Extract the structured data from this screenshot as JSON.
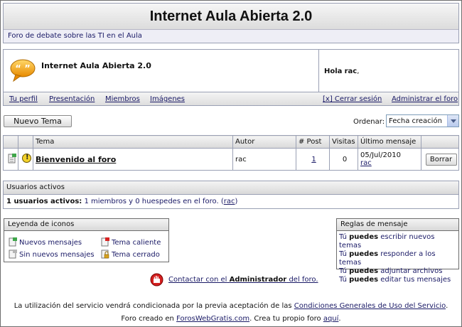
{
  "header": {
    "title": "Internet Aula Abierta 2.0",
    "subtitle": "Foro de debate sobre las TI en el Aula"
  },
  "panel": {
    "forum_name": "Internet Aula Abierta 2.0",
    "greeting_prefix": "Hola",
    "username": "rac",
    "greeting_suffix": ",",
    "links": {
      "profile": "Tu perfil",
      "presentation": "Presentación",
      "members": "Miembros",
      "images": "Imágenes",
      "logout": "[x] Cerrar sesión",
      "admin": "Administrar el foro"
    }
  },
  "toolbar": {
    "new_topic": "Nuevo Tema",
    "order_label": "Ordenar:",
    "order_value": "Fecha creación"
  },
  "topics_table": {
    "headers": {
      "topic": "Tema",
      "author": "Autor",
      "posts": "# Post",
      "visits": "Visitas",
      "last": "Último mensaje"
    },
    "rows": [
      {
        "title": "Bienvenido al foro",
        "author": "rac",
        "posts": "1",
        "visits": "0",
        "last_date": "05/Jul/2010",
        "last_user": "rac",
        "delete_label": "Borrar"
      }
    ]
  },
  "active_users": {
    "header": "Usuarios activos",
    "label": "1 usuarios activos:",
    "text": "1 miembros y 0 huespedes en el foro. (",
    "user": "rac",
    "close": ")"
  },
  "legend": {
    "header": "Leyenda de iconos",
    "items": [
      "Nuevos mensajes",
      "Sin nuevos mensajes",
      "Tema caliente",
      "Tema cerrado"
    ]
  },
  "rules": {
    "header": "Reglas de mensaje",
    "items": [
      {
        "pre": "Tú",
        "bold": "puedes",
        "post": "escribir nuevos temas"
      },
      {
        "pre": "Tú",
        "bold": "puedes",
        "post": "responder a los temas"
      },
      {
        "pre": "Tú",
        "bold": "puedes",
        "post": "adjuntar archivos"
      },
      {
        "pre": "Tú",
        "bold": "puedes",
        "post": "editar tus mensajes"
      }
    ]
  },
  "contact": {
    "pre": "Contactar con el",
    "bold": "Administrador",
    "post": "del foro."
  },
  "footer": {
    "line1_pre": "La utilización del servicio vendrá condicionada por la previa aceptación de las",
    "line1_link": "Condiciones Generales de Uso del Servicio",
    "line1_post": ".",
    "line2_pre": "Foro creado en",
    "line2_link1": "ForosWebGratis.com",
    "line2_mid": ". Crea tu propio foro",
    "line2_link2": "aquí",
    "line2_post": "."
  }
}
